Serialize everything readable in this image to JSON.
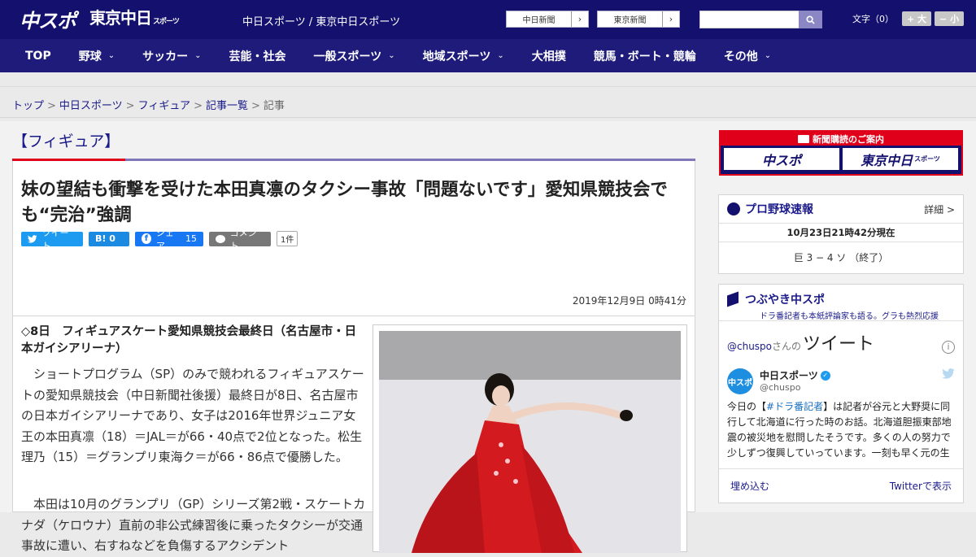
{
  "header": {
    "logo_chuspo": "中スポ",
    "logo_tokyo": "東京中日",
    "logo_tokyo_small": "スポーツ",
    "site_name": "中日スポーツ / 東京中日スポーツ",
    "ext_links": [
      {
        "label": "中日新聞",
        "arrow": "›"
      },
      {
        "label": "東京新聞",
        "arrow": "›"
      }
    ],
    "search_placeholder": "",
    "font_label": "文字（0）",
    "font_bigger": "+ 大",
    "font_smaller": "− 小"
  },
  "nav": {
    "items": [
      {
        "label": "TOP",
        "chev": ""
      },
      {
        "label": "野球",
        "chev": "⌄"
      },
      {
        "label": "サッカー",
        "chev": "⌄"
      },
      {
        "label": "芸能・社会",
        "chev": ""
      },
      {
        "label": "一般スポーツ",
        "chev": "⌄"
      },
      {
        "label": "地域スポーツ",
        "chev": "⌄"
      },
      {
        "label": "大相撲",
        "chev": ""
      },
      {
        "label": "競馬・ボート・競輪",
        "chev": ""
      },
      {
        "label": "その他",
        "chev": "⌄"
      }
    ]
  },
  "breadcrumb": {
    "items": [
      "トップ",
      "中日スポーツ",
      "フィギュア",
      "記事一覧"
    ],
    "sep": ">",
    "current": "記事"
  },
  "article": {
    "category": "【フィギュア】",
    "headline": "妹の望結も衝撃を受けた本田真凛のタクシー事故「問題ないです」愛知県競技会でも“完治”強調",
    "share": {
      "tweet": "ツイート",
      "hatena": "B! 0",
      "facebook_label": "シェア",
      "facebook_count": "15",
      "comment": "コメント",
      "comment_count": "1件"
    },
    "date": "2019年12月9日 0時41分",
    "lead": "◇8日　フィギュアスケート愛知県競技会最終日（名古屋市・日本ガイシアリーナ）",
    "para1": "　ショートプログラム（SP）のみで競われるフィギュアスケートの愛知県競技会（中日新聞社後援）最終日が8日、名古屋市の日本ガイシアリーナであり、女子は2016年世界ジュニア女王の本田真凛（18）＝JAL＝が66・40点で2位となった。松生理乃（15）＝グランプリ東海ク＝が66・86点で優勝した。",
    "para2": "　本田は10月のグランプリ（GP）シリーズ第2戦・スケートカナダ（ケロウナ）直前の非公式練習後に乗ったタクシーが交通事故に遭い、右すねなどを負傷するアクシデント"
  },
  "sidebar": {
    "ad_title": "新聞購読のご案内",
    "ad_chuspo": "中スポ",
    "ad_tokyo": "東京中日",
    "ad_tokyo_small": "スポーツ",
    "baseball": {
      "title": "プロ野球速報",
      "more": "詳細 >",
      "timestamp": "10月23日21時42分現在",
      "score": "巨 3 − 4 ソ （終了）"
    },
    "twitter": {
      "title": "つぶやき中スポ",
      "subtitle": "ドラ番記者も本紙評論家も語る。グラも熱烈応援",
      "account_link": "@chuspo",
      "account_suffix": "さんの",
      "tweets_label": "ツイート",
      "info": "i",
      "user_name": "中日スポーツ",
      "user_handle": "@chuspo",
      "avatar_text": "中スポ",
      "tweet_prefix": "今日の【",
      "tweet_tag": "#ドラ番記者",
      "tweet_body": "】は記者が谷元と大野奨に同行して北海道に行った時のお話。北海道胆振東部地震の被災地を慰問したそうです。多くの人の努力で少しずつ復興していっています。一刻も早く元の生",
      "embed": "埋め込む",
      "view_on": "Twitterで表示"
    }
  }
}
